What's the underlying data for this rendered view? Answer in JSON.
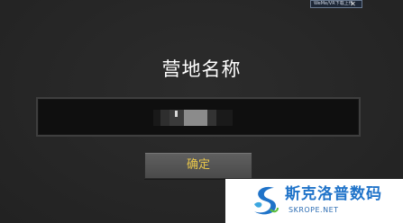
{
  "top_bar": {
    "widget_text": "WeMe/VR下载上传",
    "close_label": "✕"
  },
  "dialog": {
    "title": "营地名称",
    "name_input": {
      "value": "",
      "obscured": true
    },
    "confirm_label": "确定"
  },
  "watermark": {
    "brand": "斯克洛普数码",
    "url": "SKROPE.NET"
  },
  "colors": {
    "background": "#272727",
    "title_text": "#ffffff",
    "input_background": "#0f0f0f",
    "button_background": "#555555",
    "button_text": "#e8c64a",
    "watermark_blue": "#1f73c9"
  },
  "icons": {
    "watermark_logo": "swoosh-logo-icon"
  }
}
